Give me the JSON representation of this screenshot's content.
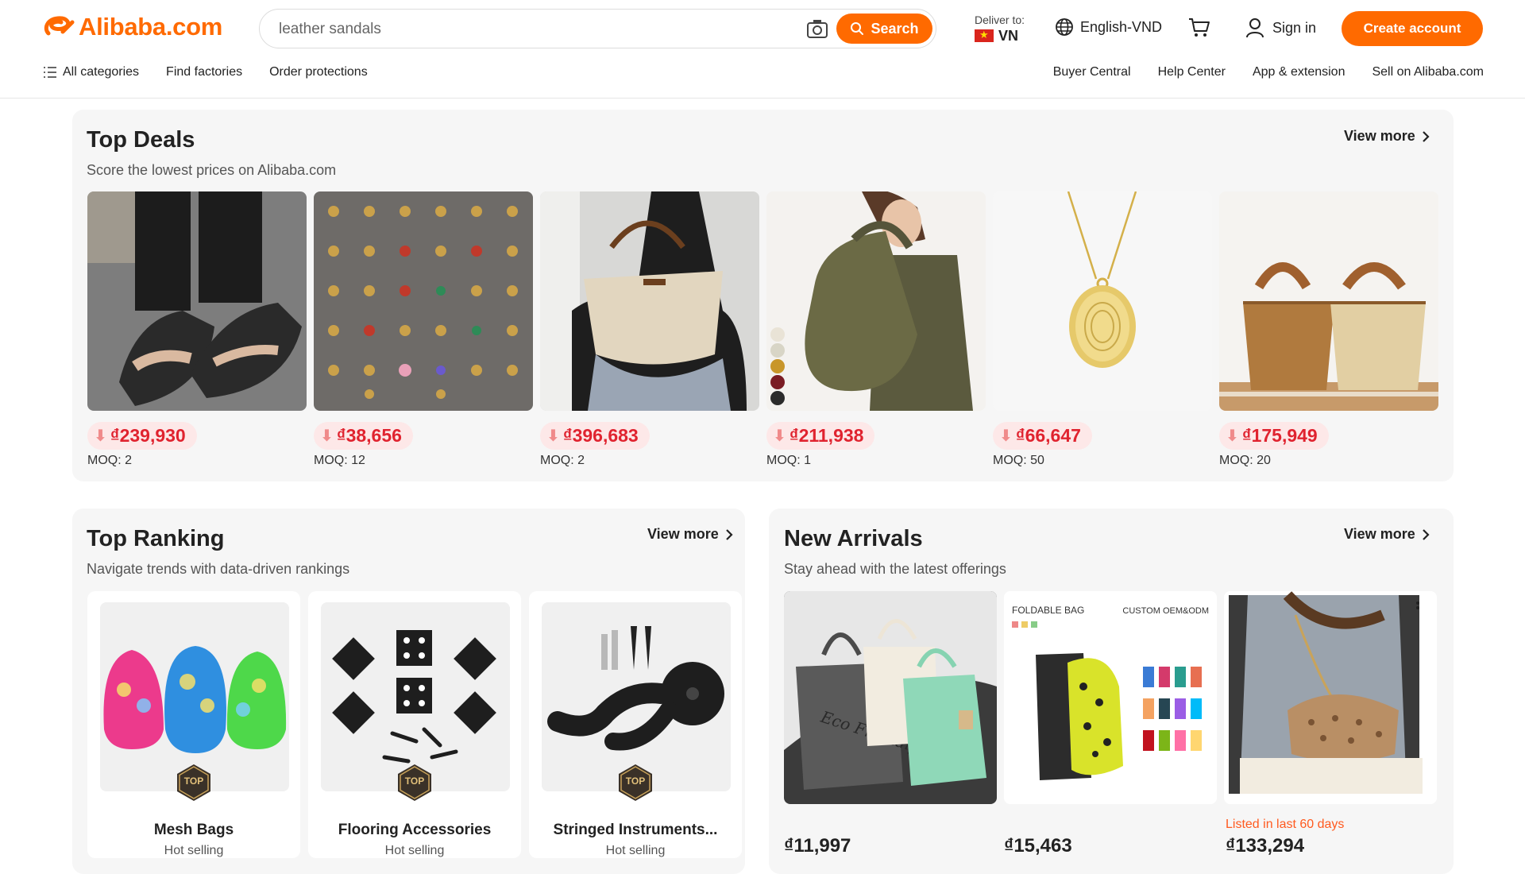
{
  "header": {
    "logo_text": "Alibaba.com",
    "search": {
      "placeholder": "leather sandals",
      "button_label": "Search"
    },
    "deliver": {
      "label": "Deliver to:",
      "country": "VN"
    },
    "language": "English-VND",
    "sign_in": "Sign in",
    "create_account": "Create account"
  },
  "nav": {
    "left": [
      "All categories",
      "Find factories",
      "Order protections"
    ],
    "right": [
      "Buyer Central",
      "Help Center",
      "App & extension",
      "Sell on Alibaba.com"
    ]
  },
  "top_deals": {
    "title": "Top Deals",
    "subtitle": "Score the lowest prices on Alibaba.com",
    "view_more": "View more",
    "items": [
      {
        "price": "₫239,930",
        "moq": "MOQ: 2"
      },
      {
        "price": "₫38,656",
        "moq": "MOQ: 12"
      },
      {
        "price": "₫396,683",
        "moq": "MOQ: 2"
      },
      {
        "price": "₫211,938",
        "moq": "MOQ: 1"
      },
      {
        "price": "₫66,647",
        "moq": "MOQ: 50"
      },
      {
        "price": "₫175,949",
        "moq": "MOQ: 20"
      }
    ]
  },
  "top_ranking": {
    "title": "Top Ranking",
    "subtitle": "Navigate trends with data-driven rankings",
    "view_more": "View more",
    "badge": "TOP",
    "items": [
      {
        "name": "Mesh Bags",
        "tag": "Hot selling"
      },
      {
        "name": "Flooring Accessories",
        "tag": "Hot selling"
      },
      {
        "name": "Stringed Instruments...",
        "tag": "Hot selling"
      }
    ]
  },
  "new_arrivals": {
    "title": "New Arrivals",
    "subtitle": "Stay ahead with the latest offerings",
    "view_more": "View more",
    "items": [
      {
        "price": "₫11,997",
        "image_text": "Eco Friendly"
      },
      {
        "price": "₫15,463",
        "image_text": "FOLDABLE BAG",
        "image_text_2": "CUSTOM OEM&ODM"
      },
      {
        "price": "₫133,294",
        "listed": "Listed in last 60 days"
      }
    ]
  },
  "colors": {
    "accent": "#ff6a00",
    "price_red": "#e0232f"
  }
}
